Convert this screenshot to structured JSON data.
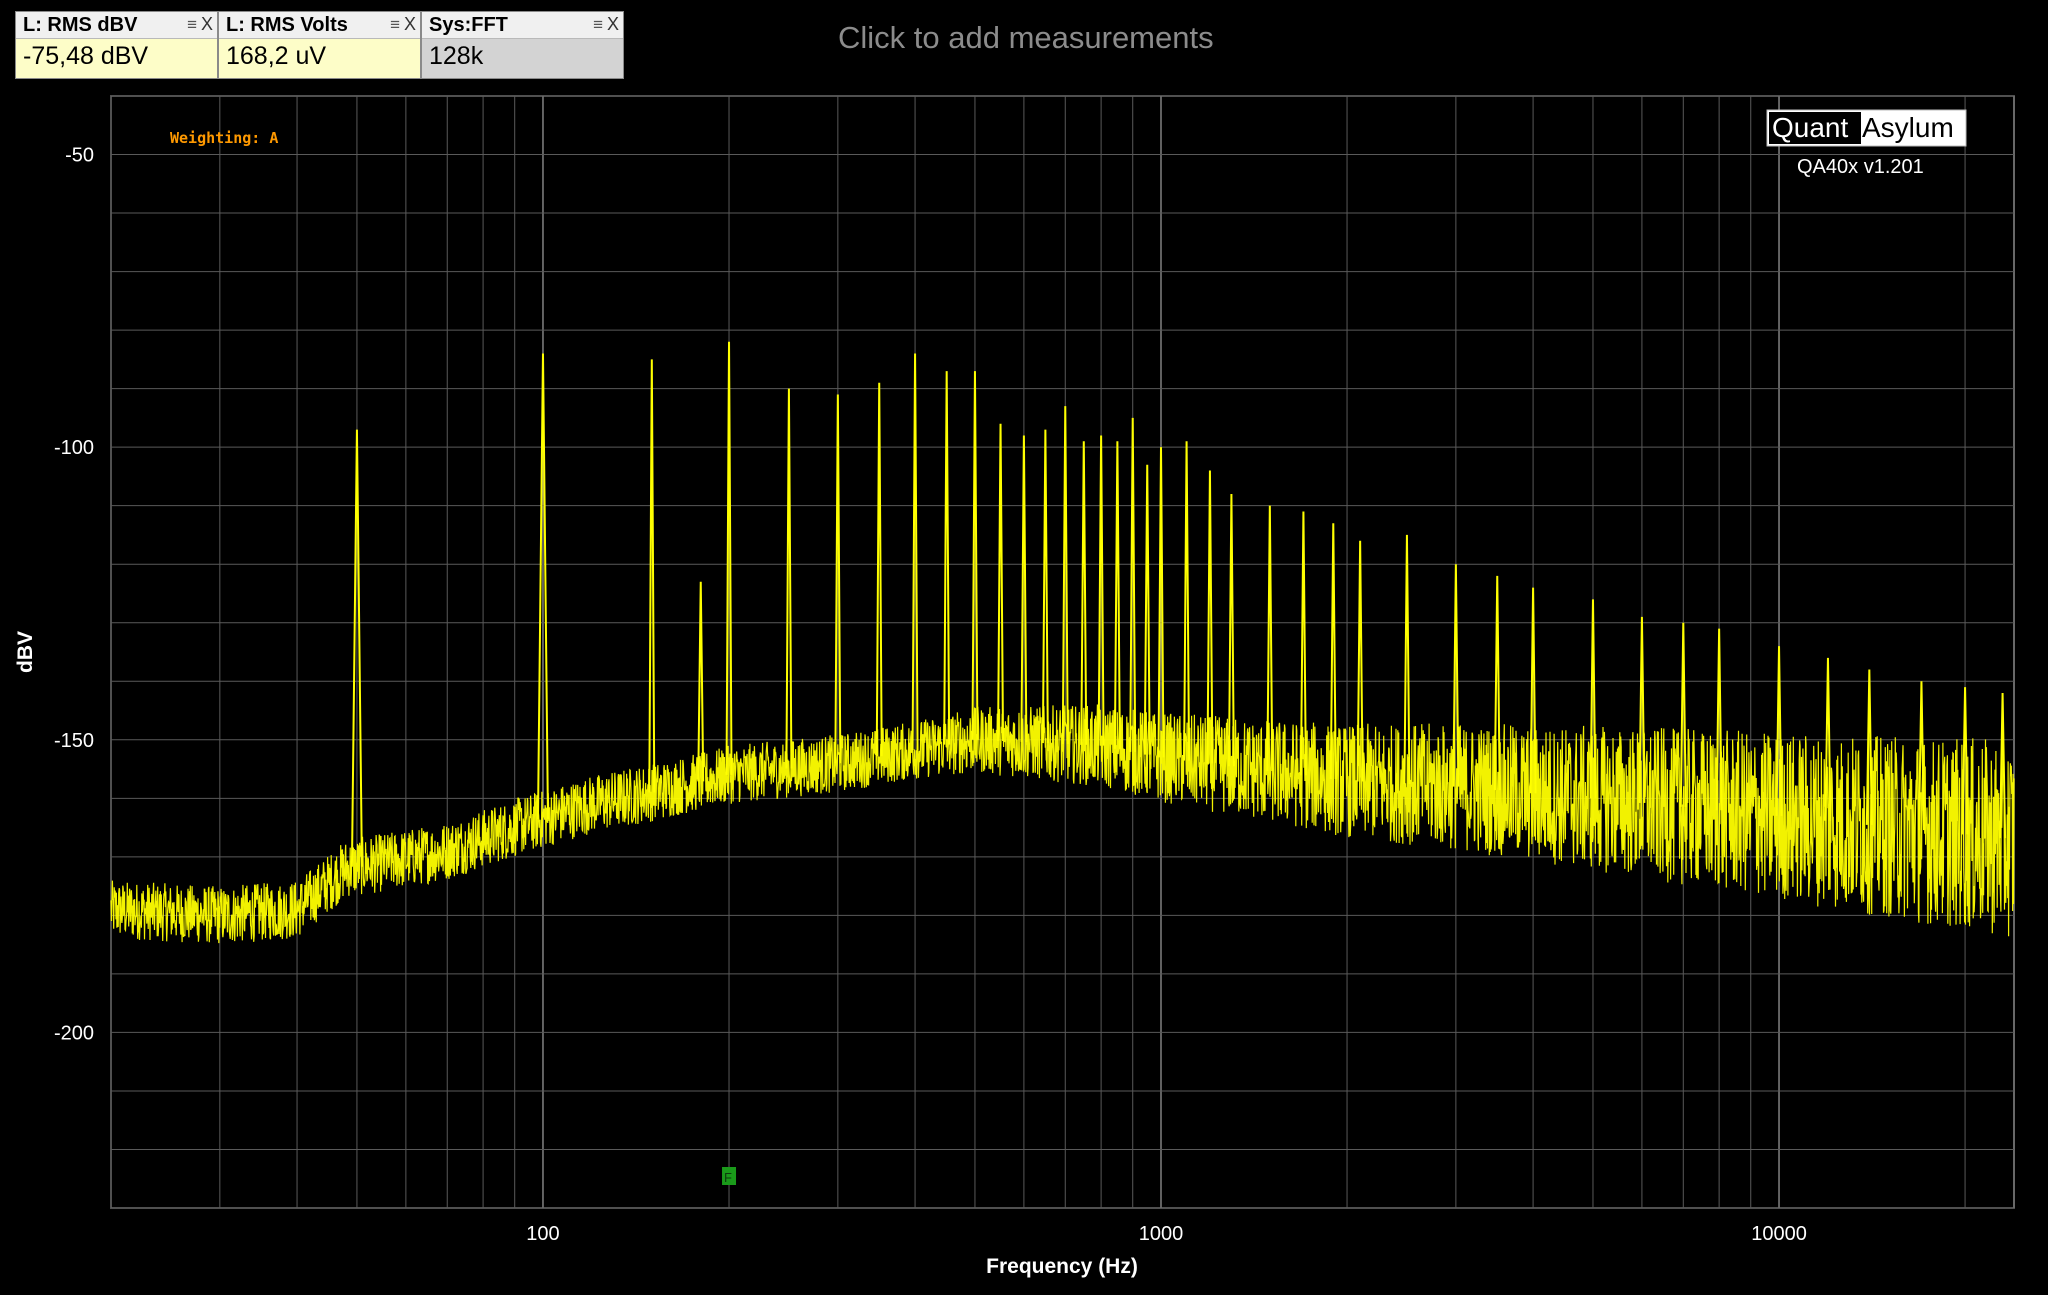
{
  "measurements": [
    {
      "title": "L: RMS dBV",
      "value": "-75,48 dBV"
    },
    {
      "title": "L: RMS Volts",
      "value": "168,2 uV"
    },
    {
      "title": "Sys:FFT",
      "value": "128k"
    }
  ],
  "click_to_add": "Click to add measurements",
  "weighting": "Weighting: A",
  "brand": {
    "left": "Quant",
    "right": "Asylum",
    "version": "QA40x v1.201"
  },
  "marker_label": "F",
  "colors": {
    "trace": "#ffff00",
    "background": "#000000",
    "grid": "#5a5a5a",
    "weighting_text": "#ff9900",
    "marker": "#1a9a1a"
  },
  "chart_data": {
    "type": "line",
    "xlabel": "Frequency (Hz)",
    "ylabel": "dBV",
    "x_scale": "log",
    "xlim": [
      20,
      24000
    ],
    "ylim": [
      -230,
      -40
    ],
    "x_ticks": [
      100,
      1000,
      10000
    ],
    "x_tick_labels": [
      "100",
      "1000",
      "10000"
    ],
    "y_ticks": [
      -50,
      -100,
      -150,
      -200
    ],
    "y_tick_labels": [
      "-50",
      "-100",
      "-150",
      "-200"
    ],
    "grid": true,
    "marker_frequency": 200,
    "noise_floor": [
      [
        20,
        -179
      ],
      [
        30,
        -180
      ],
      [
        40,
        -179
      ],
      [
        48,
        -172
      ],
      [
        55,
        -171
      ],
      [
        70,
        -169
      ],
      [
        90,
        -165
      ],
      [
        120,
        -161
      ],
      [
        150,
        -159
      ],
      [
        200,
        -156
      ],
      [
        300,
        -154
      ],
      [
        500,
        -150
      ],
      [
        800,
        -151
      ],
      [
        1000,
        -153
      ],
      [
        2000,
        -157
      ],
      [
        3000,
        -158
      ],
      [
        5000,
        -160
      ],
      [
        10000,
        -163
      ],
      [
        24000,
        -167
      ]
    ],
    "peaks": [
      {
        "f": 50,
        "dbv": -97
      },
      {
        "f": 100,
        "dbv": -84
      },
      {
        "f": 150,
        "dbv": -85
      },
      {
        "f": 180,
        "dbv": -123
      },
      {
        "f": 200,
        "dbv": -82
      },
      {
        "f": 250,
        "dbv": -90
      },
      {
        "f": 300,
        "dbv": -91
      },
      {
        "f": 350,
        "dbv": -89
      },
      {
        "f": 400,
        "dbv": -84
      },
      {
        "f": 450,
        "dbv": -87
      },
      {
        "f": 500,
        "dbv": -87
      },
      {
        "f": 550,
        "dbv": -96
      },
      {
        "f": 600,
        "dbv": -98
      },
      {
        "f": 650,
        "dbv": -97
      },
      {
        "f": 700,
        "dbv": -93
      },
      {
        "f": 750,
        "dbv": -99
      },
      {
        "f": 800,
        "dbv": -98
      },
      {
        "f": 850,
        "dbv": -99
      },
      {
        "f": 900,
        "dbv": -95
      },
      {
        "f": 950,
        "dbv": -103
      },
      {
        "f": 1000,
        "dbv": -100
      },
      {
        "f": 1100,
        "dbv": -99
      },
      {
        "f": 1200,
        "dbv": -104
      },
      {
        "f": 1300,
        "dbv": -108
      },
      {
        "f": 1500,
        "dbv": -110
      },
      {
        "f": 1700,
        "dbv": -111
      },
      {
        "f": 1900,
        "dbv": -113
      },
      {
        "f": 2100,
        "dbv": -116
      },
      {
        "f": 2500,
        "dbv": -115
      },
      {
        "f": 3000,
        "dbv": -120
      },
      {
        "f": 3500,
        "dbv": -122
      },
      {
        "f": 4000,
        "dbv": -124
      },
      {
        "f": 5000,
        "dbv": -126
      },
      {
        "f": 6000,
        "dbv": -129
      },
      {
        "f": 7000,
        "dbv": -130
      },
      {
        "f": 8000,
        "dbv": -131
      },
      {
        "f": 10000,
        "dbv": -134
      },
      {
        "f": 12000,
        "dbv": -136
      },
      {
        "f": 14000,
        "dbv": -138
      },
      {
        "f": 17000,
        "dbv": -140
      },
      {
        "f": 20000,
        "dbv": -141
      },
      {
        "f": 23000,
        "dbv": -142
      }
    ]
  }
}
